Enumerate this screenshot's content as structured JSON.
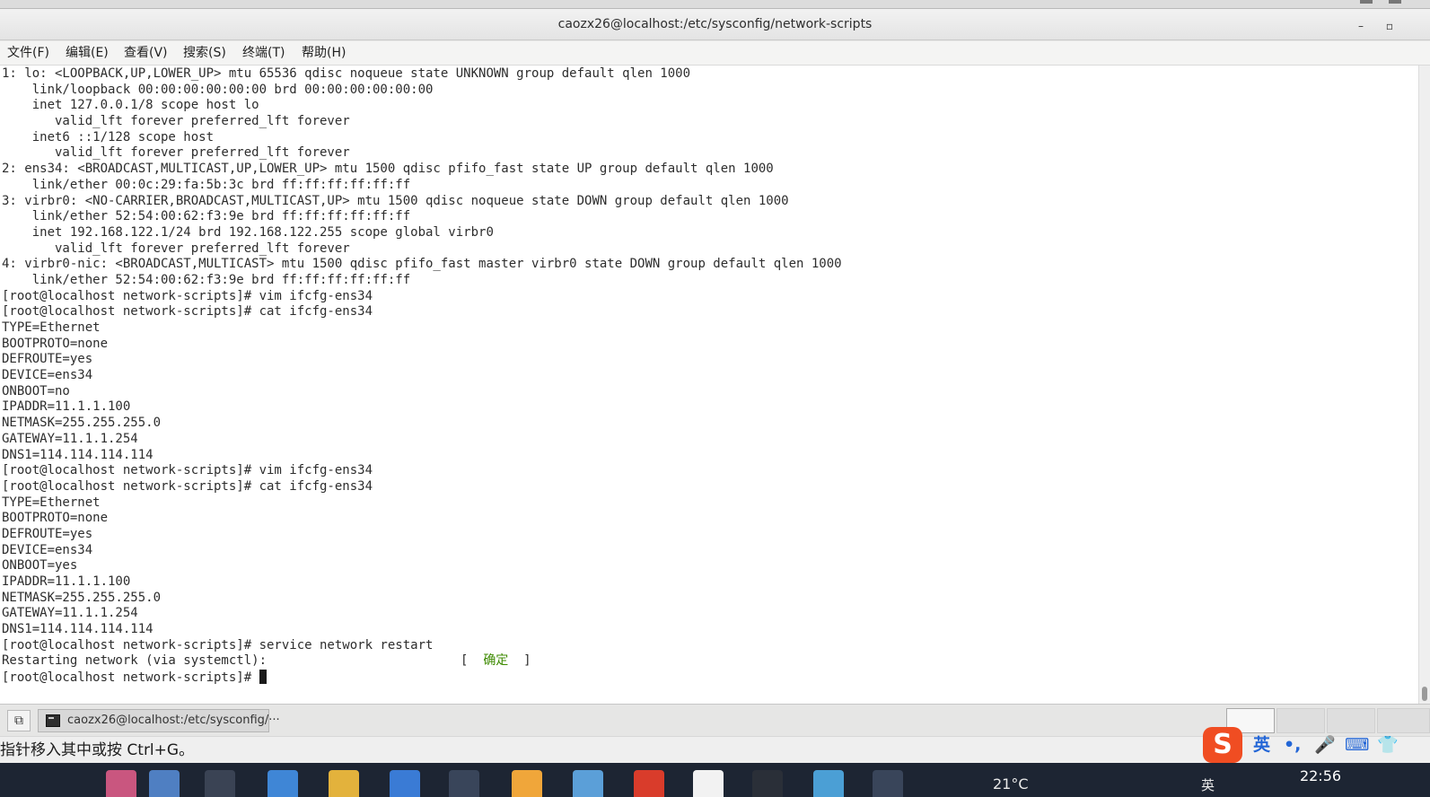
{
  "window": {
    "title": "caozx26@localhost:/etc/sysconfig/network-scripts",
    "minimize_glyph": "–",
    "maximize_glyph": "▫"
  },
  "menu": [
    {
      "label": "文件(F)"
    },
    {
      "label": "编辑(E)"
    },
    {
      "label": "查看(V)"
    },
    {
      "label": "搜索(S)"
    },
    {
      "label": "终端(T)"
    },
    {
      "label": "帮助(H)"
    }
  ],
  "terminal": {
    "lines": [
      "1: lo: <LOOPBACK,UP,LOWER_UP> mtu 65536 qdisc noqueue state UNKNOWN group default qlen 1000",
      "    link/loopback 00:00:00:00:00:00 brd 00:00:00:00:00:00",
      "    inet 127.0.0.1/8 scope host lo",
      "       valid_lft forever preferred_lft forever",
      "    inet6 ::1/128 scope host",
      "       valid_lft forever preferred_lft forever",
      "2: ens34: <BROADCAST,MULTICAST,UP,LOWER_UP> mtu 1500 qdisc pfifo_fast state UP group default qlen 1000",
      "    link/ether 00:0c:29:fa:5b:3c brd ff:ff:ff:ff:ff:ff",
      "3: virbr0: <NO-CARRIER,BROADCAST,MULTICAST,UP> mtu 1500 qdisc noqueue state DOWN group default qlen 1000",
      "    link/ether 52:54:00:62:f3:9e brd ff:ff:ff:ff:ff:ff",
      "    inet 192.168.122.1/24 brd 192.168.122.255 scope global virbr0",
      "       valid_lft forever preferred_lft forever",
      "4: virbr0-nic: <BROADCAST,MULTICAST> mtu 1500 qdisc pfifo_fast master virbr0 state DOWN group default qlen 1000",
      "    link/ether 52:54:00:62:f3:9e brd ff:ff:ff:ff:ff:ff",
      "[root@localhost network-scripts]# vim ifcfg-ens34",
      "[root@localhost network-scripts]# cat ifcfg-ens34",
      "TYPE=Ethernet",
      "BOOTPROTO=none",
      "DEFROUTE=yes",
      "DEVICE=ens34",
      "ONBOOT=no",
      "IPADDR=11.1.1.100",
      "NETMASK=255.255.255.0",
      "GATEWAY=11.1.1.254",
      "DNS1=114.114.114.114",
      "[root@localhost network-scripts]# vim ifcfg-ens34",
      "[root@localhost network-scripts]# cat ifcfg-ens34",
      "TYPE=Ethernet",
      "BOOTPROTO=none",
      "DEFROUTE=yes",
      "DEVICE=ens34",
      "ONBOOT=yes",
      "IPADDR=11.1.1.100",
      "NETMASK=255.255.255.0",
      "GATEWAY=11.1.1.254",
      "DNS1=114.114.114.114",
      "[root@localhost network-scripts]# service network restart"
    ],
    "restart_line": {
      "text": "Restarting network (via systemctl):",
      "bracket_open": "[",
      "status": "确定",
      "bracket_close": "]"
    },
    "prompt": "[root@localhost network-scripts]# "
  },
  "taskbar": {
    "show_desktop_glyph": "⧉",
    "task_label": "caozx26@localhost:/etc/sysconfig/···"
  },
  "status_text": "指针移入其中或按 Ctrl+G。",
  "ime": {
    "logo": "S",
    "lang": "英",
    "punct": "•,",
    "mic": "🎤",
    "keyboard": "⌨",
    "skin": "👕"
  },
  "system_tray": {
    "weather": "21°C",
    "lang": "英",
    "clock": "22:56"
  },
  "colors": {
    "ok_green": "#3d8a00",
    "ime_orange": "#f04d22",
    "win_taskbar": "#1d2533"
  }
}
